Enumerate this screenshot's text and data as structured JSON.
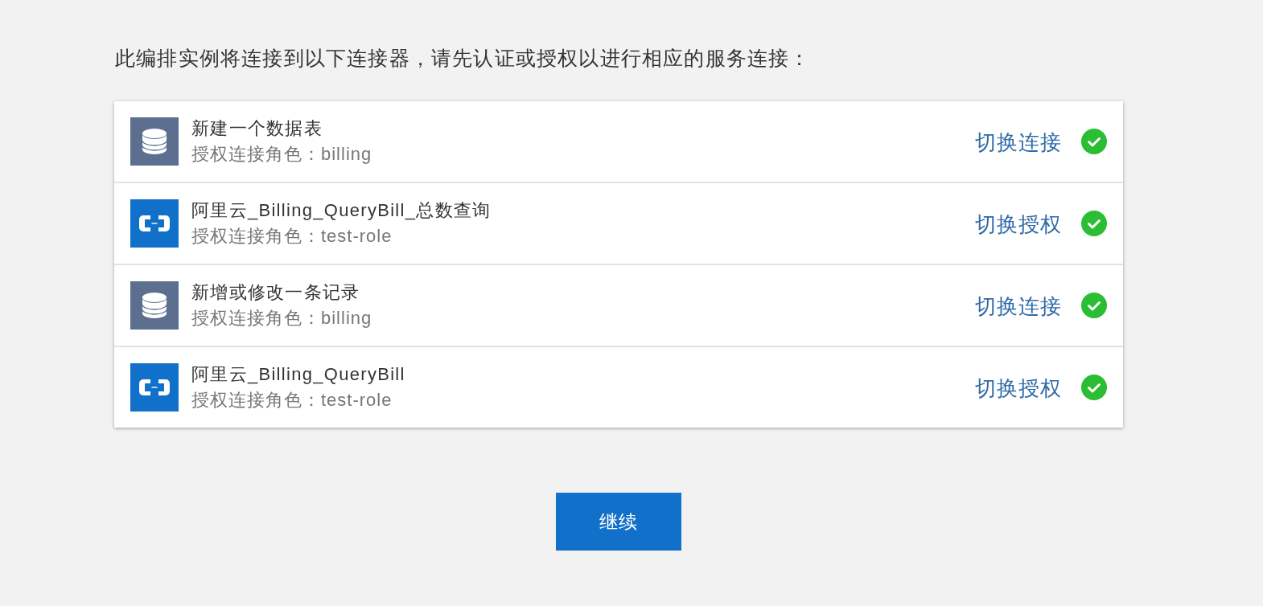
{
  "intro": "此编排实例将连接到以下连接器，请先认证或授权以进行相应的服务连接：",
  "connectors": [
    {
      "kind": "database",
      "title": "新建一个数据表",
      "role": "授权连接角色：billing",
      "action": "切换连接",
      "authorized": true
    },
    {
      "kind": "cloud",
      "title": "阿里云_Billing_QueryBill_总数查询",
      "role": "授权连接角色：test-role",
      "action": "切换授权",
      "authorized": true
    },
    {
      "kind": "database",
      "title": "新增或修改一条记录",
      "role": "授权连接角色：billing",
      "action": "切换连接",
      "authorized": true
    },
    {
      "kind": "cloud",
      "title": "阿里云_Billing_QueryBill",
      "role": "授权连接角色：test-role",
      "action": "切换授权",
      "authorized": true
    }
  ],
  "continue_button": "继续"
}
